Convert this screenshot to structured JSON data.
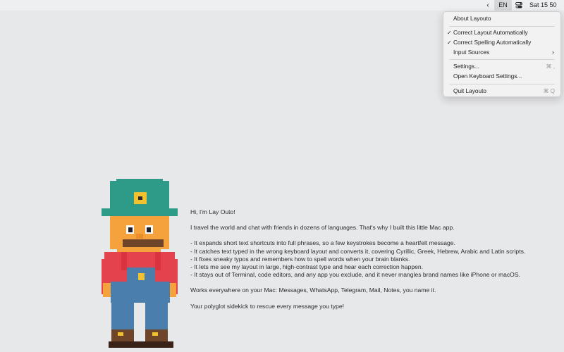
{
  "menubar": {
    "chevron_icon": "chevron-left-icon",
    "language": "EN",
    "control_icon": "control-center-icon",
    "clock": "Sat 15 50"
  },
  "menu": {
    "about": "About Layouto",
    "correct_layout": "Correct Layout Automatically",
    "correct_spelling": "Correct Spelling Automatically",
    "input_sources": "Input Sources",
    "settings": "Settings...",
    "settings_shortcut": "⌘ ,",
    "keyboard_settings": "Open Keyboard Settings...",
    "quit": "Quit Layouto",
    "quit_shortcut": "⌘ Q",
    "checkmark": "✓",
    "submenu_arrow": "›"
  },
  "intro": {
    "greeting": "Hi, I'm Lay Outo!",
    "story": "I travel the world and chat with friends in dozens of languages. That's why I built this little Mac app.",
    "features": [
      "- It expands short text shortcuts into full phrases, so a few keystrokes become a heartfelt message.",
      "- It catches text typed in the wrong keyboard layout and converts it, covering Cyrillic, Greek, Hebrew, Arabic and Latin scripts.",
      "- It fixes sneaky typos and remembers how to spell words when your brain blanks.",
      "- It lets me see my layout in large, high-contrast type and hear each correction happen.",
      "- It stays out of Terminal, code editors, and any app you exclude, and it never mangles brand names like iPhone or macOS."
    ],
    "works": "Works everywhere on your Mac: Messages, WhatsApp, Telegram, Mail, Notes, you name it.",
    "closing": "Your polyglot sidekick to rescue every message you type!"
  },
  "colors": {
    "hat": "#2e9a88",
    "hat_badge": "#f2c12e",
    "skin": "#f5a23c",
    "mustache": "#6e4528",
    "shirt": "#e4424d",
    "overalls": "#4a7fad",
    "boots": "#6e4528",
    "sole": "#3a2316",
    "button": "#f2c12e"
  }
}
